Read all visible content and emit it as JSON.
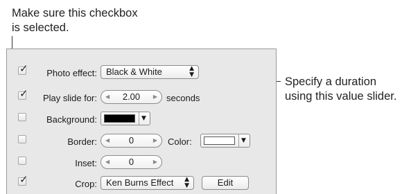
{
  "callouts": {
    "top_line1": "Make sure this checkbox",
    "top_line2": "is selected.",
    "right_line1": "Specify a duration",
    "right_line2": "using this value slider."
  },
  "rows": {
    "photo_effect": {
      "label": "Photo effect:",
      "checked": true,
      "value": "Black & White"
    },
    "play_slide": {
      "label": "Play slide for:",
      "checked": true,
      "value": "2.00",
      "unit": "seconds"
    },
    "background": {
      "label": "Background:",
      "checked": false,
      "color": "#000000"
    },
    "border": {
      "label": "Border:",
      "checked": false,
      "value": "0",
      "color_label": "Color:",
      "color": "#ffffff"
    },
    "inset": {
      "label": "Inset:",
      "checked": false,
      "value": "0"
    },
    "crop": {
      "label": "Crop:",
      "checked": true,
      "value": "Ken Burns Effect",
      "edit_label": "Edit"
    }
  },
  "glyphs": {
    "check": "✓",
    "popup_arrows_up": "▲",
    "popup_arrows_down": "▼",
    "dropdown": "▼",
    "slider_left": "◀",
    "slider_right": "▶"
  }
}
